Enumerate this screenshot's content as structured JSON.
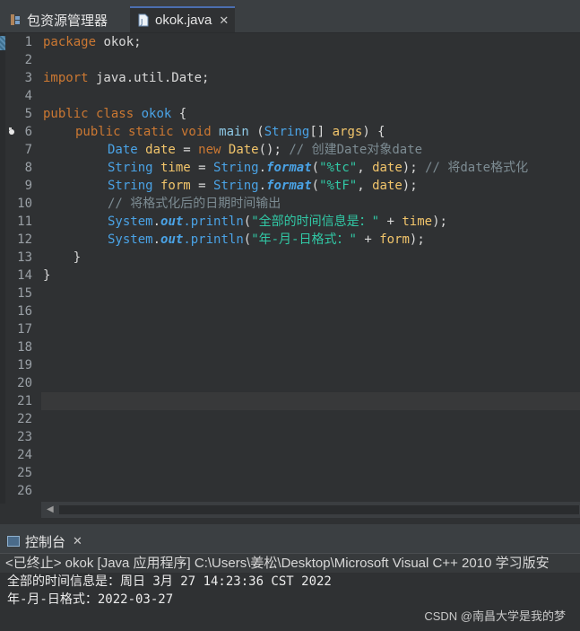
{
  "tabs": {
    "package_explorer": "包资源管理器",
    "editor_file": "okok.java",
    "close_glyph": "✕"
  },
  "editor": {
    "line_numbers": [
      "1",
      "2",
      "3",
      "4",
      "5",
      "6",
      "7",
      "8",
      "9",
      "10",
      "11",
      "12",
      "13",
      "14",
      "15",
      "16",
      "17",
      "18",
      "19",
      "20",
      "21",
      "22",
      "23",
      "24",
      "25",
      "26"
    ],
    "line1_kw": "package",
    "line1_rest": " okok;",
    "line3_kw": "import",
    "line3_rest": " java.util.Date;",
    "line5_kw": "public class",
    "line5_name": " okok",
    "line5_rest": " {",
    "line6_kw": "public static void",
    "line6_fn": " main",
    "line6_p1": " (",
    "line6_type": "String",
    "line6_p2": "[] ",
    "line6_var": "args",
    "line6_p3": ") {",
    "line7_type": "Date",
    "line7_var": " date",
    "line7_p1": " = ",
    "line7_kw": "new",
    "line7_fn": " Date",
    "line7_p2": "(); ",
    "line7_cmt": "// 创建Date对象date",
    "line8_type": "String",
    "line8_var": " time",
    "line8_p1": " = ",
    "line8_type2": "String",
    "line8_dot": ".",
    "line8_fn": "format",
    "line8_p2": "(",
    "line8_str": "\"%tc\"",
    "line8_p3": ", ",
    "line8_var2": "date",
    "line8_p4": "); ",
    "line8_cmt": "// 将date格式化",
    "line9_type": "String",
    "line9_var": " form",
    "line9_p1": " = ",
    "line9_type2": "String",
    "line9_dot": ".",
    "line9_fn": "format",
    "line9_p2": "(",
    "line9_str": "\"%tF\"",
    "line9_p3": ", ",
    "line9_var2": "date",
    "line9_p4": ");",
    "line10_cmt": "// 将格式化后的日期时间输出",
    "line11_type": "System",
    "line11_dot": ".",
    "line11_out": "out",
    "line11_fn": ".println",
    "line11_p1": "(",
    "line11_str": "\"全部的时间信息是：\"",
    "line11_p2": " + ",
    "line11_var": "time",
    "line11_p3": ");",
    "line12_type": "System",
    "line12_dot": ".",
    "line12_out": "out",
    "line12_fn": ".println",
    "line12_p1": "(",
    "line12_str": "\"年-月-日格式：\"",
    "line12_p2": " + ",
    "line12_var": "form",
    "line12_p3": ");",
    "line13": "    }",
    "line14": "}"
  },
  "console": {
    "tab_label": "控制台",
    "close_glyph": "✕",
    "status": "<已终止> okok [Java 应用程序] C:\\Users\\姜松\\Desktop\\Microsoft Visual C++ 2010 学习版安",
    "output_line1": "全部的时间信息是：周日 3月 27 14:23:36 CST 2022",
    "output_line2": "年-月-日格式：2022-03-27"
  },
  "watermark": "CSDN @南昌大学是我的梦",
  "colors": {
    "background": "#2f3133",
    "keyword": "#cc7832",
    "type": "#4aa3e6",
    "variable": "#f2c56b",
    "string": "#31c9a6",
    "comment": "#7d8c93",
    "active_tab_accent": "#4b6eaf"
  }
}
